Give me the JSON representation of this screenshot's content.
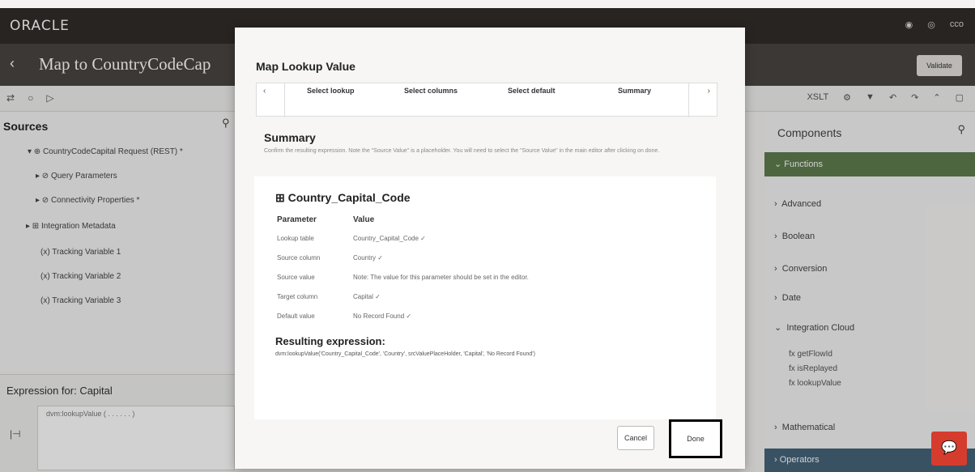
{
  "app": {
    "logo": "ORACLE",
    "top_icons": [
      "notifications-icon",
      "help-icon",
      "user-avatar"
    ],
    "avatar_text": "cco"
  },
  "title": {
    "back": "‹",
    "text": "Map to CountryCodeCap",
    "validate_label": "Validate"
  },
  "toolbar": {
    "left_icons": [
      "⇄",
      "○",
      "▷"
    ],
    "right_xslt": "XSLT",
    "right_icons": [
      "⚙",
      "▼",
      "↶",
      "↷",
      "⌃",
      "▢"
    ]
  },
  "sources": {
    "title": "Sources",
    "items": [
      "▾ ⊕ CountryCodeCapital Request (REST) *",
      "▸ ⊘ Query Parameters",
      "▸ ⊘ Connectivity Properties *",
      "▸ ⊞ Integration Metadata",
      "(x) Tracking Variable 1",
      "(x) Tracking Variable 2",
      "(x) Tracking Variable 3"
    ]
  },
  "expression": {
    "title": "Expression for: Capital",
    "text": "dvm:lookupValue ( . . . . . . )",
    "icon": "|⊣"
  },
  "components": {
    "title": "Components",
    "functions": "Functions",
    "items": [
      "Advanced",
      "Boolean",
      "Conversion",
      "Date",
      "Integration Cloud"
    ],
    "sub_items": [
      "fx getFlowId",
      "fx isReplayed",
      "fx lookupValue"
    ],
    "mathematical": "Mathematical",
    "operators": "Operators"
  },
  "modal": {
    "title": "Map Lookup Value",
    "train": {
      "prev": "‹",
      "next": "›",
      "steps": [
        "Select lookup",
        "Select columns",
        "Select default",
        "Summary"
      ]
    },
    "summary_heading": "Summary",
    "summary_desc": "Confirm the resulting expression. Note the \"Source Value\" is a placeholder. You will need to select the \"Source Value\" in the main editor after clicking on done.",
    "lookup_name": "⊞ Country_Capital_Code",
    "header_param": "Parameter",
    "header_value": "Value",
    "rows": [
      {
        "label": "Lookup table",
        "value": "Country_Capital_Code ✓"
      },
      {
        "label": "Source column",
        "value": "Country ✓"
      },
      {
        "label": "Source value",
        "value": "Note: The value for this parameter should be set in the editor."
      },
      {
        "label": "Target column",
        "value": "Capital ✓"
      },
      {
        "label": "Default value",
        "value": "No Record Found ✓"
      }
    ],
    "resulting_title": "Resulting expression:",
    "resulting_expr": "dvm:lookupValue('Country_Capital_Code', 'Country', srcValuePlaceHolder, 'Capital', 'No Record Found')",
    "cancel": "Cancel",
    "done": "Done"
  }
}
